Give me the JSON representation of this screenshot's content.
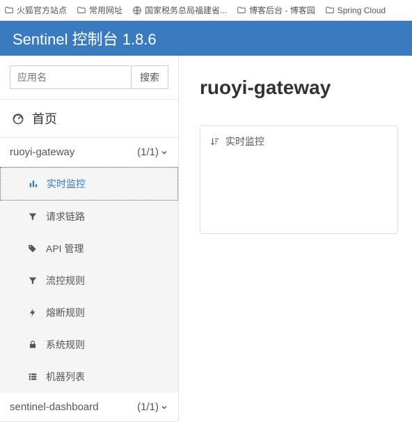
{
  "bookmarks": [
    {
      "label": "火狐官方站点",
      "type": "folder"
    },
    {
      "label": "常用网址",
      "type": "folder"
    },
    {
      "label": "国家税务总局福建省...",
      "type": "globe"
    },
    {
      "label": "博客后台 - 博客园",
      "type": "folder"
    },
    {
      "label": "Spring Cloud",
      "type": "folder"
    }
  ],
  "header": {
    "title": "Sentinel 控制台 1.8.6"
  },
  "search": {
    "placeholder": "应用名",
    "button": "搜索"
  },
  "nav": {
    "home": "首页",
    "apps": [
      {
        "name": "ruoyi-gateway",
        "count": "(1/1)",
        "expanded": true
      },
      {
        "name": "sentinel-dashboard",
        "count": "(1/1)",
        "expanded": false
      }
    ],
    "sub": [
      {
        "label": "实时监控",
        "icon": "barchart",
        "active": true
      },
      {
        "label": "请求链路",
        "icon": "filter"
      },
      {
        "label": "API 管理",
        "icon": "tags"
      },
      {
        "label": "流控规则",
        "icon": "filter"
      },
      {
        "label": "熔断规则",
        "icon": "flash"
      },
      {
        "label": "系统规则",
        "icon": "lock"
      },
      {
        "label": "机器列表",
        "icon": "list"
      }
    ]
  },
  "main": {
    "title": "ruoyi-gateway",
    "panel_title": "实时监控"
  }
}
